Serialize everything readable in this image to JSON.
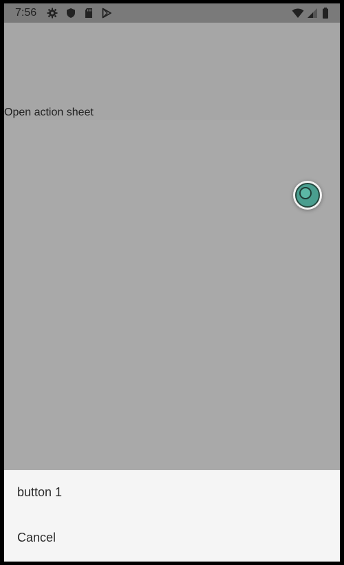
{
  "status_bar": {
    "time": "7:56",
    "left_icons": [
      "gear-icon",
      "shield-icon",
      "sd-card-icon",
      "play-store-icon"
    ],
    "right_icons": [
      "wifi-icon",
      "cell-signal-icon",
      "battery-icon"
    ]
  },
  "main": {
    "open_action_sheet_label": "Open action sheet"
  },
  "action_sheet": {
    "items": [
      {
        "label": "button 1"
      },
      {
        "label": "Cancel"
      }
    ]
  },
  "colors": {
    "scrim": "#a9a9a9",
    "status_bar": "#7a7a7a",
    "sheet_background": "#f5f5f5",
    "touch_indicator": "#4a9e8f"
  }
}
